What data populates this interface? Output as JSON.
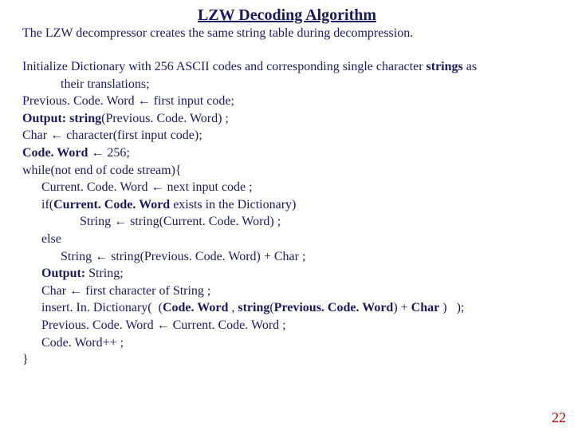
{
  "title": "LZW Decoding Algorithm",
  "subtitle": "The LZW decompressor creates the same string table during decompression.",
  "lines": [
    {
      "indent": 0,
      "segs": [
        {
          "t": "Initialize Dictionary with 256 ASCII codes and corresponding single character "
        },
        {
          "t": "strings",
          "b": true
        },
        {
          "t": " as"
        }
      ]
    },
    {
      "indent": 2,
      "segs": [
        {
          "t": "their translations;"
        }
      ]
    },
    {
      "indent": 0,
      "segs": [
        {
          "t": "Previous. Code. Word ← first input code;"
        }
      ]
    },
    {
      "indent": 0,
      "segs": [
        {
          "t": "Output:",
          "b": true
        },
        {
          "t": " "
        },
        {
          "t": "string",
          "b": true
        },
        {
          "t": "(Previous. Code. Word) ;"
        }
      ]
    },
    {
      "indent": 0,
      "segs": [
        {
          "t": "Char ← character(first input code);"
        }
      ]
    },
    {
      "indent": 0,
      "segs": [
        {
          "t": "Code. Word",
          "b": true
        },
        {
          "t": " ← 256;"
        }
      ]
    },
    {
      "indent": 0,
      "segs": [
        {
          "t": "while(not end of code stream){"
        }
      ]
    },
    {
      "indent": 1,
      "segs": [
        {
          "t": "Current. Code. Word ← next input code ;"
        }
      ]
    },
    {
      "indent": 1,
      "segs": [
        {
          "t": "if("
        },
        {
          "t": "Current. Code. Word",
          "b": true
        },
        {
          "t": " exists in the Dictionary)"
        }
      ]
    },
    {
      "indent": 3,
      "segs": [
        {
          "t": "String ← string(Current. Code. Word) ;"
        }
      ]
    },
    {
      "indent": 1,
      "segs": [
        {
          "t": "else"
        }
      ]
    },
    {
      "indent": 2,
      "segs": [
        {
          "t": "String ← string(Previous. Code. Word) + Char ;"
        }
      ]
    },
    {
      "indent": 1,
      "segs": [
        {
          "t": "Output:",
          "b": true
        },
        {
          "t": " String;"
        }
      ]
    },
    {
      "indent": 1,
      "segs": [
        {
          "t": "Char ← first character of String ;"
        }
      ]
    },
    {
      "indent": 1,
      "segs": [
        {
          "t": "insert. In. Dictionary(  ("
        },
        {
          "t": "Code. Word",
          "b": true
        },
        {
          "t": " , "
        },
        {
          "t": "string",
          "b": true
        },
        {
          "t": "("
        },
        {
          "t": "Previous. Code. Word",
          "b": true
        },
        {
          "t": ") + "
        },
        {
          "t": "Char",
          "b": true
        },
        {
          "t": " )   );"
        }
      ]
    },
    {
      "indent": 1,
      "segs": [
        {
          "t": "Previous. Code. Word ← Current. Code. Word ;"
        }
      ]
    },
    {
      "indent": 1,
      "segs": [
        {
          "t": "Code. Word++ ;"
        }
      ]
    },
    {
      "indent": 0,
      "segs": [
        {
          "t": "}"
        }
      ]
    }
  ],
  "pagenum": "22",
  "indent_unit": "      "
}
